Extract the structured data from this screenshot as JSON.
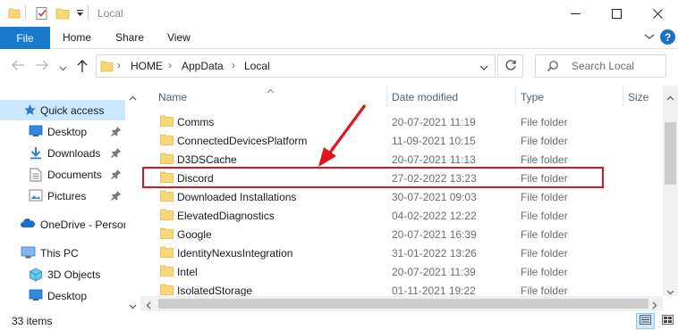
{
  "window": {
    "title": "Local"
  },
  "ribbon": {
    "file": "File",
    "tabs": [
      "Home",
      "Share",
      "View"
    ]
  },
  "address": {
    "crumbs": [
      "HOME",
      "AppData",
      "Local"
    ],
    "separator": "›"
  },
  "search": {
    "placeholder": "Search Local"
  },
  "nav": {
    "items": [
      {
        "label": "Quick access",
        "icon": "star-icon",
        "pinned": false,
        "selected": true
      },
      {
        "label": "Desktop",
        "icon": "desktop-icon",
        "pinned": true
      },
      {
        "label": "Downloads",
        "icon": "download-icon",
        "pinned": true
      },
      {
        "label": "Documents",
        "icon": "documents-icon",
        "pinned": true
      },
      {
        "label": "Pictures",
        "icon": "pictures-icon",
        "pinned": true
      },
      {
        "label": "OneDrive - Persor",
        "icon": "onedrive-icon",
        "pinned": false
      },
      {
        "label": "This PC",
        "icon": "pc-icon",
        "pinned": false
      },
      {
        "label": "3D Objects",
        "icon": "3d-objects-icon",
        "pinned": false
      },
      {
        "label": "Desktop",
        "icon": "desktop-icon",
        "pinned": false
      }
    ]
  },
  "columns": {
    "name": "Name",
    "date": "Date modified",
    "type": "Type",
    "size": "Size"
  },
  "files": [
    {
      "name": "Comms",
      "date": "20-07-2021 11:19",
      "type": "File folder"
    },
    {
      "name": "ConnectedDevicesPlatform",
      "date": "11-09-2021 10:15",
      "type": "File folder"
    },
    {
      "name": "D3DSCache",
      "date": "20-07-2021 11:13",
      "type": "File folder"
    },
    {
      "name": "Discord",
      "date": "27-02-2022 13:23",
      "type": "File folder",
      "highlighted": true
    },
    {
      "name": "Downloaded Installations",
      "date": "30-07-2021 09:03",
      "type": "File folder"
    },
    {
      "name": "ElevatedDiagnostics",
      "date": "04-02-2022 12:22",
      "type": "File folder"
    },
    {
      "name": "Google",
      "date": "20-07-2021 16:39",
      "type": "File folder"
    },
    {
      "name": "IdentityNexusIntegration",
      "date": "31-01-2022 13:26",
      "type": "File folder"
    },
    {
      "name": "Intel",
      "date": "20-07-2021 11:39",
      "type": "File folder"
    },
    {
      "name": "IsolatedStorage",
      "date": "01-11-2021 19:22",
      "type": "File folder"
    }
  ],
  "status": {
    "item_count": "33 items"
  },
  "colors": {
    "accent": "#1979ca",
    "selection": "#cce8ff",
    "highlight_box": "#e0141e",
    "folder": "#f8d775"
  }
}
